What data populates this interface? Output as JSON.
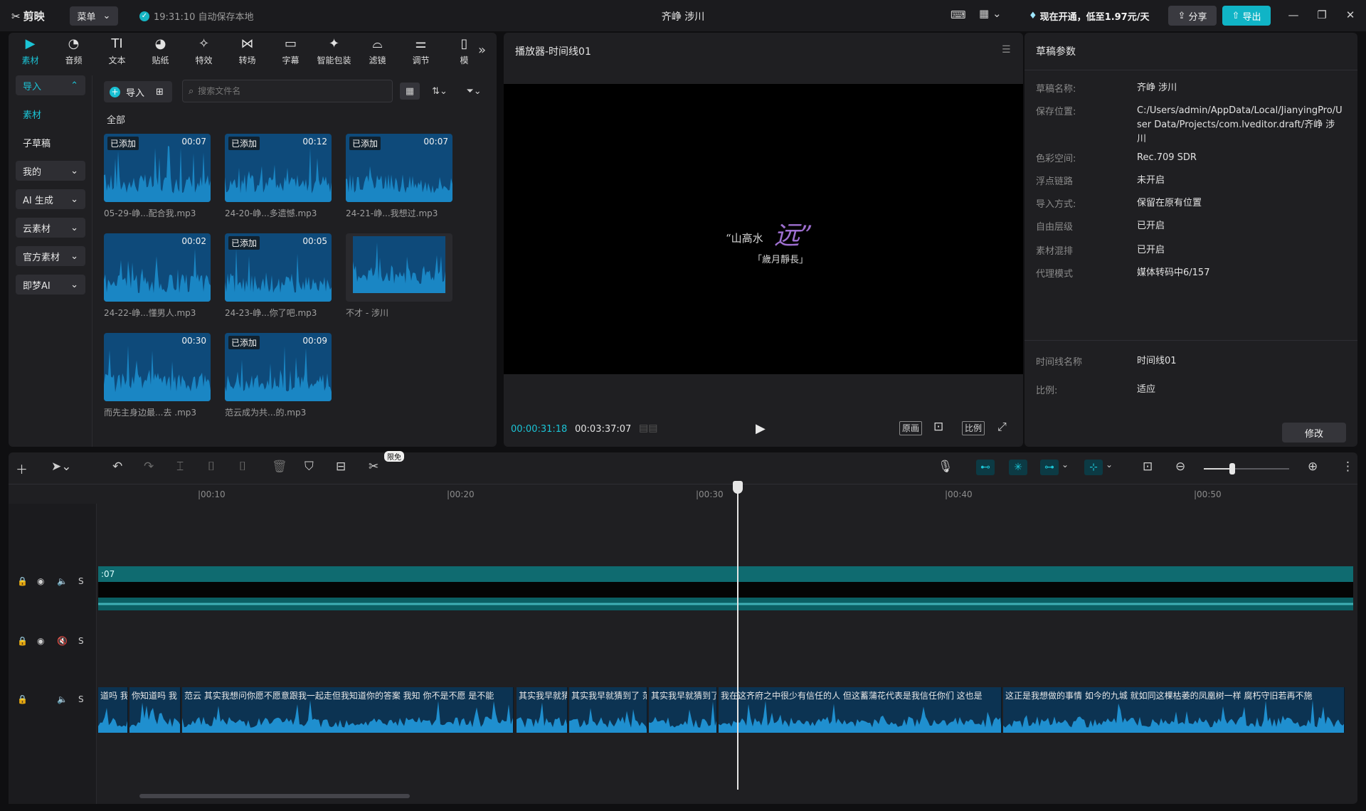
{
  "titlebar": {
    "app_name": "剪映",
    "menu_label": "菜单",
    "autosave_text": "19:31:10 自动保存本地",
    "project_title": "齐峥 涉川",
    "promo_text": "现在开通，低至1.97元/天",
    "share_label": "分享",
    "export_label": "导出"
  },
  "tool_tabs": [
    {
      "label": "素材",
      "icon": "media-icon"
    },
    {
      "label": "音频",
      "icon": "audio-icon"
    },
    {
      "label": "文本",
      "icon": "text-icon"
    },
    {
      "label": "贴纸",
      "icon": "sticker-icon"
    },
    {
      "label": "特效",
      "icon": "effects-icon"
    },
    {
      "label": "转场",
      "icon": "transition-icon"
    },
    {
      "label": "字幕",
      "icon": "subtitle-icon"
    },
    {
      "label": "智能包装",
      "icon": "smart-pack-icon"
    },
    {
      "label": "滤镜",
      "icon": "filter-icon"
    },
    {
      "label": "调节",
      "icon": "adjust-icon"
    },
    {
      "label": "模",
      "icon": "template-icon"
    }
  ],
  "left_nav": {
    "import": "导入",
    "material": "素材",
    "sub_draft": "子草稿",
    "mine": "我的",
    "ai_gen": "AI 生成",
    "cloud": "云素材",
    "official": "官方素材",
    "jimeng": "即梦AI"
  },
  "media": {
    "import_label": "导入",
    "search_placeholder": "搜索文件名",
    "all_label": "全部",
    "items": [
      {
        "name": "05-29-峥...配合我.mp3",
        "duration": "00:07",
        "badge": "已添加"
      },
      {
        "name": "24-20-峥...多遗憾.mp3",
        "duration": "00:12",
        "badge": "已添加"
      },
      {
        "name": "24-21-峥...我想过.mp3",
        "duration": "00:07",
        "badge": "已添加"
      },
      {
        "name": "24-22-峥...懂男人.mp3",
        "duration": "00:02",
        "badge": ""
      },
      {
        "name": "24-23-峥...你了吧.mp3",
        "duration": "00:05",
        "badge": "已添加"
      },
      {
        "name": "不才 - 涉川",
        "duration": "",
        "badge": ""
      },
      {
        "name": "而先主身边最...去 .mp3",
        "duration": "00:30",
        "badge": ""
      },
      {
        "name": "范云成为共...的.mp3",
        "duration": "00:09",
        "badge": "已添加"
      }
    ]
  },
  "player": {
    "title": "播放器-时间线01",
    "logo_main": "“山高水",
    "logo_big": "远”",
    "logo_sub": "「歲月靜長」",
    "current_time": "00:00:31:18",
    "total_time": "00:03:37:07",
    "original_label": "原画",
    "ratio_label": "比例"
  },
  "params": {
    "title": "草稿参数",
    "rows": [
      {
        "key": "草稿名称:",
        "value": "齐峥 涉川"
      },
      {
        "key": "保存位置:",
        "value": "C:/Users/admin/AppData/Local/JianyingPro/User Data/Projects/com.lveditor.draft/齐峥 涉川"
      },
      {
        "key": "色彩空间:",
        "value": "Rec.709 SDR"
      },
      {
        "key": "浮点链路",
        "value": "未开启"
      },
      {
        "key": "导入方式:",
        "value": "保留在原有位置"
      },
      {
        "key": "自由层级",
        "value": "已开启"
      },
      {
        "key": "素材混排",
        "value": "已开启"
      },
      {
        "key": "代理模式",
        "value": "媒体转码中6/157"
      }
    ],
    "timeline_rows": [
      {
        "key": "时间线名称",
        "value": "时间线01"
      },
      {
        "key": "比例:",
        "value": "适应"
      }
    ],
    "modify_label": "修改"
  },
  "timeline": {
    "free_tag": "限免",
    "ticks": [
      "|00:10",
      "|00:20",
      "|00:30",
      "|00:40",
      "|00:50"
    ],
    "video_clip_label": ":07",
    "audio_clips": [
      {
        "label": "道吗 我"
      },
      {
        "label": "你知道吗 我"
      },
      {
        "label": "范云 其实我想问你愿不愿意跟我一起走但我知道你的答案 我知 你不是不愿 是不能"
      },
      {
        "label": "其实我早就猜"
      },
      {
        "label": "其实我早就猜到了 范云想"
      },
      {
        "label": "其实我早就猜到了"
      },
      {
        "label": "我在这齐府之中很少有信任的人 但这蓄蒲花代表是我信任你们 这也是"
      },
      {
        "label": "这正是我想做的事情 如今的九城 就如同这棵枯萎的凤凰树一样 腐朽守旧若再不施"
      }
    ]
  },
  "colors": {
    "accent": "#1bc4d6",
    "panel": "#1f1f22",
    "audio_clip": "#0c3352",
    "thumb": "#0e4a7a"
  }
}
